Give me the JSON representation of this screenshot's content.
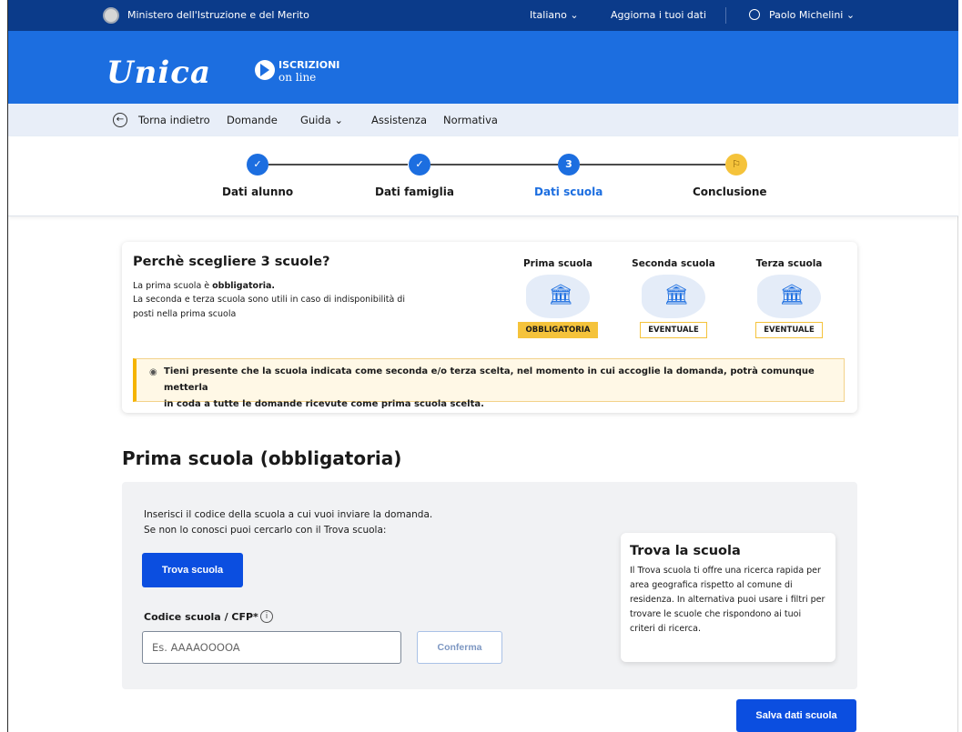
{
  "topbar": {
    "ministry": "Ministero dell'Istruzione e del Merito",
    "language": "Italiano ⌄",
    "update_data": "Aggiorna i tuoi dati",
    "user_name": "Paolo Michelini ⌄"
  },
  "brand": {
    "logo": "Unica",
    "iscrizioni_line1": "ISCRIZIONI",
    "iscrizioni_line2": "on line"
  },
  "nav": {
    "back": "Torna indietro",
    "items": [
      "Domande",
      "Guida ⌄",
      "Assistenza",
      "Normativa"
    ]
  },
  "stepper": {
    "steps": [
      {
        "label": "Dati alunno",
        "marker": "✓"
      },
      {
        "label": "Dati famiglia",
        "marker": "✓"
      },
      {
        "label": "Dati scuola",
        "marker": "3"
      },
      {
        "label": "Conclusione",
        "marker": "⚐"
      }
    ]
  },
  "info_card": {
    "title": "Perchè scegliere 3 scuole?",
    "line1_prefix": "La prima scuola è ",
    "line1_bold": "obbligatoria.",
    "line2": "La seconda e terza scuola sono utili in caso di indisponibilità di",
    "line3": "posti nella prima scuola",
    "schools": [
      {
        "title": "Prima scuola",
        "badge": "OBBLIGATORIA"
      },
      {
        "title": "Seconda scuola",
        "badge": "EVENTUALE"
      },
      {
        "title": "Terza scuola",
        "badge": "EVENTUALE"
      }
    ],
    "note_line1": "Tieni presente che la scuola indicata come seconda e/o terza scelta, nel momento in cui accoglie la domanda, potrà comunque metterla",
    "note_line2": "in coda a tutte le domande ricevute come prima scuola scelta."
  },
  "section": {
    "title": "Prima scuola (obbligatoria)",
    "intro1": "Inserisci il codice della scuola a cui vuoi inviare la domanda.",
    "intro2": "Se non lo conosci puoi cercarlo con il Trova scuola:",
    "find_button": "Trova scuola",
    "code_label": "Codice scuola / CFP*",
    "code_placeholder": "Es. AAAAOOOOA",
    "confirm_button": "Conferma",
    "aside_title": "Trova la scuola",
    "aside_text": "Il Trova scuola ti offre una ricerca rapida per area geografica rispetto al comune di residenza. In alternativa puoi usare i filtri per trovare le scuole che rispondono ai tuoi criteri di ricerca."
  },
  "save_button": "Salva dati scuola",
  "colors": {
    "ministry_bar": "#0b3b8a",
    "brand_blue": "#1c6ee0",
    "accent_yellow": "#f5c33b",
    "primary_button": "#0b4ee0"
  }
}
